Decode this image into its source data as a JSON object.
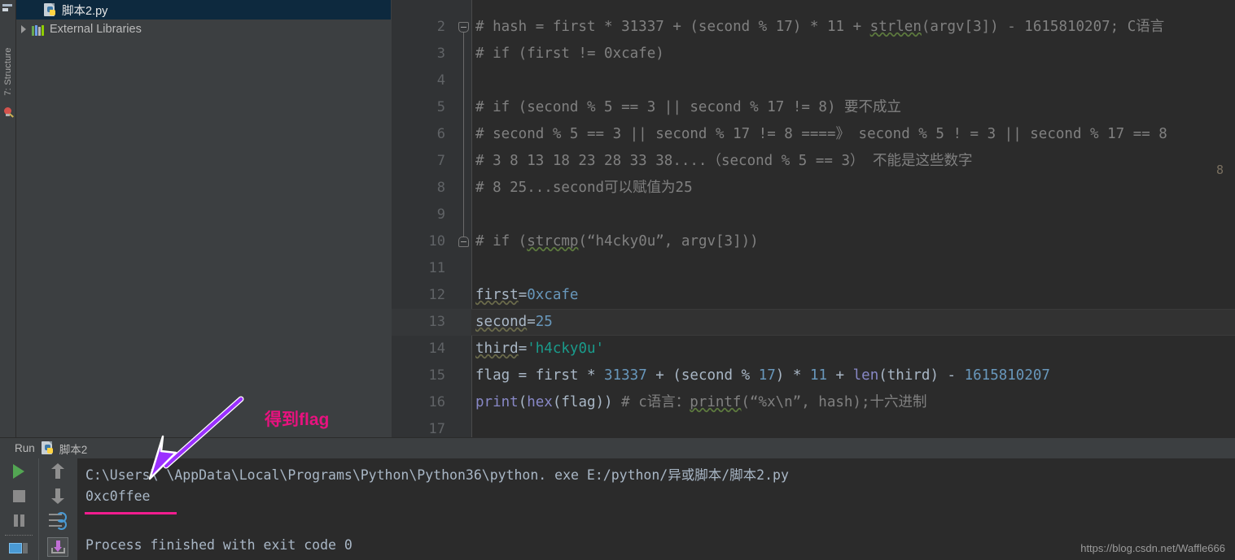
{
  "toolstrip": {
    "structure_label": "7: Structure",
    "top_icon": "panel-icon",
    "bulb_icon": "lightbulb-icon"
  },
  "project_tree": {
    "items": [
      {
        "label": "脚本2.py",
        "icon": "python-file-icon",
        "selected": true,
        "has_arrow": false,
        "indent": 1
      },
      {
        "label": "External Libraries",
        "icon": "libraries-icon",
        "selected": false,
        "has_arrow": true,
        "indent": 0
      }
    ]
  },
  "editor": {
    "lines": [
      {
        "num": "2",
        "fold": "top",
        "current": false,
        "tokens": [
          {
            "t": "# hash = first * 31337 + (second % 17) * 11 + ",
            "c": "cmt"
          },
          {
            "t": "strlen",
            "c": "cmt typo"
          },
          {
            "t": "(argv[3]) - 1615810207; C语言",
            "c": "cmt"
          }
        ]
      },
      {
        "num": "3",
        "current": false,
        "tokens": [
          {
            "t": "# if (first != 0xcafe)",
            "c": "cmt"
          }
        ]
      },
      {
        "num": "4",
        "current": false,
        "tokens": []
      },
      {
        "num": "5",
        "current": false,
        "tokens": [
          {
            "t": "# if (second % 5 == 3 || second % 17 != 8) 要不成立",
            "c": "cmt"
          }
        ]
      },
      {
        "num": "6",
        "current": false,
        "tokens": [
          {
            "t": "# second % 5 == 3 || second % 17 != 8   ====》  second % 5 ! = 3 || second % 17 == 8",
            "c": "cmt"
          }
        ]
      },
      {
        "num": "7",
        "current": false,
        "tokens": [
          {
            "t": "# 3  8  13  18  23  28  33  38....（second % 5 == 3） 不能是这些数字",
            "c": "cmt"
          }
        ]
      },
      {
        "num": "8",
        "current": false,
        "tokens": [
          {
            "t": "# 8  25...second可以赋值为25",
            "c": "cmt"
          }
        ]
      },
      {
        "num": "9",
        "current": false,
        "tokens": []
      },
      {
        "num": "10",
        "fold": "bottom",
        "current": false,
        "tokens": [
          {
            "t": "# if (",
            "c": "cmt"
          },
          {
            "t": "strcmp",
            "c": "cmt typo"
          },
          {
            "t": "(“h4cky0u”, argv[3]))",
            "c": "cmt"
          }
        ]
      },
      {
        "num": "11",
        "current": false,
        "tokens": []
      },
      {
        "num": "12",
        "current": false,
        "tokens": [
          {
            "t": "first",
            "c": "idn typo2"
          },
          {
            "t": "=",
            "c": "idn"
          },
          {
            "t": "0xcafe",
            "c": "num"
          }
        ]
      },
      {
        "num": "13",
        "current": true,
        "tokens": [
          {
            "t": "second",
            "c": "idn typo2"
          },
          {
            "t": "=",
            "c": "idn"
          },
          {
            "t": "25",
            "c": "num"
          }
        ]
      },
      {
        "num": "14",
        "current": false,
        "tokens": [
          {
            "t": "third",
            "c": "idn typo2"
          },
          {
            "t": "=",
            "c": "idn"
          },
          {
            "t": "'h4cky0u'",
            "c": "str"
          }
        ]
      },
      {
        "num": "15",
        "current": false,
        "tokens": [
          {
            "t": "flag = first * ",
            "c": "idn"
          },
          {
            "t": "31337",
            "c": "num"
          },
          {
            "t": " + (second % ",
            "c": "idn"
          },
          {
            "t": "17",
            "c": "num"
          },
          {
            "t": ") * ",
            "c": "idn"
          },
          {
            "t": "11",
            "c": "num"
          },
          {
            "t": " + ",
            "c": "idn"
          },
          {
            "t": "len",
            "c": "bif"
          },
          {
            "t": "(third) - ",
            "c": "idn"
          },
          {
            "t": "1615810207",
            "c": "num"
          }
        ]
      },
      {
        "num": "16",
        "current": false,
        "tokens": [
          {
            "t": "print",
            "c": "bif"
          },
          {
            "t": "(",
            "c": "idn"
          },
          {
            "t": "hex",
            "c": "bif"
          },
          {
            "t": "(flag))  ",
            "c": "idn"
          },
          {
            "t": "# c语言：",
            "c": "cmt"
          },
          {
            "t": "printf",
            "c": "cmt typo"
          },
          {
            "t": "(“%x\\n”, hash);十六进制",
            "c": "cmt"
          }
        ]
      },
      {
        "num": "17",
        "current": false,
        "tokens": []
      }
    ],
    "error_stripe_marker": "8"
  },
  "run_window": {
    "title": "Run",
    "config_name": "脚本2",
    "buttons": [
      {
        "name": "rerun-button",
        "icon": "play-icon"
      },
      {
        "name": "stop-button",
        "icon": "stop-icon"
      },
      {
        "name": "pause-button",
        "icon": "pause-icon"
      },
      {
        "name": "toggle-console-button",
        "icon": "console-icon"
      },
      {
        "name": "up-stack-button",
        "icon": "arrow-up-icon"
      },
      {
        "name": "down-stack-button",
        "icon": "arrow-down-icon"
      },
      {
        "name": "soft-wrap-button",
        "icon": "soft-wrap-icon"
      },
      {
        "name": "scroll-to-end-button",
        "icon": "scroll-to-end-icon"
      }
    ],
    "console": {
      "lines": [
        "C:\\Users\\        \\AppData\\Local\\Programs\\Python\\Python36\\python. exe E:/python/异或脚本/脚本2.py",
        "0xc0ffee",
        "",
        "Process finished with exit code 0"
      ],
      "highlighted_line_index": 1
    }
  },
  "annotation": {
    "label": "得到flag",
    "color": "#e8127f",
    "arrow_color": "#9b30ff",
    "underline_color": "#f21d8f"
  },
  "watermark": "https://blog.csdn.net/Waffle666"
}
